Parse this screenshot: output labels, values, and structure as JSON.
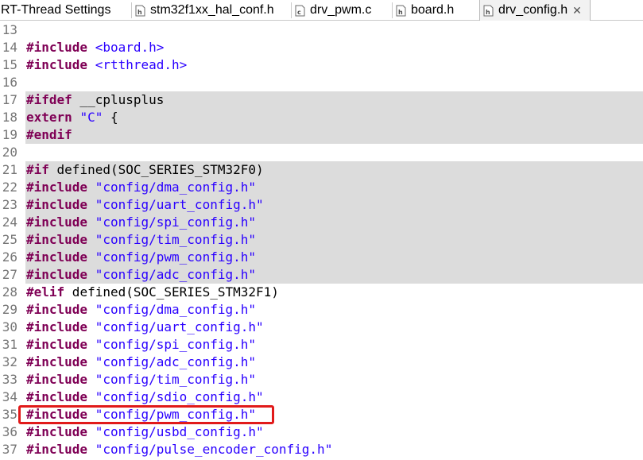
{
  "tabs": [
    {
      "label": "RT-Thread Settings",
      "icon": "none"
    },
    {
      "label": "stm32f1xx_hal_conf.h",
      "icon": "header-file-icon"
    },
    {
      "label": "drv_pwm.c",
      "icon": "c-file-icon"
    },
    {
      "label": "board.h",
      "icon": "header-file-icon"
    },
    {
      "label": "drv_config.h",
      "icon": "header-file-icon",
      "active": true,
      "close": "✕"
    }
  ],
  "editor": {
    "lines": [
      {
        "num": "13",
        "shaded": false,
        "tokens": []
      },
      {
        "num": "14",
        "shaded": false,
        "tokens": [
          {
            "t": "#include",
            "c": "kw"
          },
          {
            "t": " "
          },
          {
            "t": "<board.h>",
            "c": "str"
          }
        ]
      },
      {
        "num": "15",
        "shaded": false,
        "tokens": [
          {
            "t": "#include",
            "c": "kw"
          },
          {
            "t": " "
          },
          {
            "t": "<rtthread.h>",
            "c": "str"
          }
        ]
      },
      {
        "num": "16",
        "shaded": false,
        "tokens": []
      },
      {
        "num": "17",
        "shaded": true,
        "tokens": [
          {
            "t": "#ifdef",
            "c": "kw"
          },
          {
            "t": " __cplusplus"
          }
        ]
      },
      {
        "num": "18",
        "shaded": true,
        "tokens": [
          {
            "t": "extern",
            "c": "kw"
          },
          {
            "t": " "
          },
          {
            "t": "\"C\"",
            "c": "str"
          },
          {
            "t": " {"
          }
        ]
      },
      {
        "num": "19",
        "shaded": true,
        "tokens": [
          {
            "t": "#endif",
            "c": "kw"
          }
        ]
      },
      {
        "num": "20",
        "shaded": false,
        "tokens": []
      },
      {
        "num": "21",
        "shaded": true,
        "tokens": [
          {
            "t": "#if",
            "c": "kw"
          },
          {
            "t": " defined(SOC_SERIES_STM32F0)"
          }
        ]
      },
      {
        "num": "22",
        "shaded": true,
        "tokens": [
          {
            "t": "#include",
            "c": "kw"
          },
          {
            "t": " "
          },
          {
            "t": "\"config/dma_config.h\"",
            "c": "str"
          }
        ]
      },
      {
        "num": "23",
        "shaded": true,
        "tokens": [
          {
            "t": "#include",
            "c": "kw"
          },
          {
            "t": " "
          },
          {
            "t": "\"config/uart_config.h\"",
            "c": "str"
          }
        ]
      },
      {
        "num": "24",
        "shaded": true,
        "tokens": [
          {
            "t": "#include",
            "c": "kw"
          },
          {
            "t": " "
          },
          {
            "t": "\"config/spi_config.h\"",
            "c": "str"
          }
        ]
      },
      {
        "num": "25",
        "shaded": true,
        "tokens": [
          {
            "t": "#include",
            "c": "kw"
          },
          {
            "t": " "
          },
          {
            "t": "\"config/tim_config.h\"",
            "c": "str"
          }
        ]
      },
      {
        "num": "26",
        "shaded": true,
        "tokens": [
          {
            "t": "#include",
            "c": "kw"
          },
          {
            "t": " "
          },
          {
            "t": "\"config/pwm_config.h\"",
            "c": "str"
          }
        ]
      },
      {
        "num": "27",
        "shaded": true,
        "tokens": [
          {
            "t": "#include",
            "c": "kw"
          },
          {
            "t": " "
          },
          {
            "t": "\"config/adc_config.h\"",
            "c": "str"
          }
        ]
      },
      {
        "num": "28",
        "shaded": false,
        "tokens": [
          {
            "t": "#elif",
            "c": "kw"
          },
          {
            "t": " defined(SOC_SERIES_STM32F1)"
          }
        ]
      },
      {
        "num": "29",
        "shaded": false,
        "tokens": [
          {
            "t": "#include",
            "c": "kw"
          },
          {
            "t": " "
          },
          {
            "t": "\"config/dma_config.h\"",
            "c": "str"
          }
        ]
      },
      {
        "num": "30",
        "shaded": false,
        "tokens": [
          {
            "t": "#include",
            "c": "kw"
          },
          {
            "t": " "
          },
          {
            "t": "\"config/uart_config.h\"",
            "c": "str"
          }
        ]
      },
      {
        "num": "31",
        "shaded": false,
        "tokens": [
          {
            "t": "#include",
            "c": "kw"
          },
          {
            "t": " "
          },
          {
            "t": "\"config/spi_config.h\"",
            "c": "str"
          }
        ]
      },
      {
        "num": "32",
        "shaded": false,
        "tokens": [
          {
            "t": "#include",
            "c": "kw"
          },
          {
            "t": " "
          },
          {
            "t": "\"config/adc_config.h\"",
            "c": "str"
          }
        ]
      },
      {
        "num": "33",
        "shaded": false,
        "tokens": [
          {
            "t": "#include",
            "c": "kw"
          },
          {
            "t": " "
          },
          {
            "t": "\"config/tim_config.h\"",
            "c": "str"
          }
        ]
      },
      {
        "num": "34",
        "shaded": false,
        "tokens": [
          {
            "t": "#include",
            "c": "kw"
          },
          {
            "t": " "
          },
          {
            "t": "\"config/sdio_config.h\"",
            "c": "str"
          }
        ]
      },
      {
        "num": "35",
        "shaded": false,
        "highlighted": true,
        "tokens": [
          {
            "t": "#include",
            "c": "kw"
          },
          {
            "t": " "
          },
          {
            "t": "\"config/pwm_config.h\"",
            "c": "str"
          }
        ]
      },
      {
        "num": "36",
        "shaded": false,
        "tokens": [
          {
            "t": "#include",
            "c": "kw"
          },
          {
            "t": " "
          },
          {
            "t": "\"config/usbd_config.h\"",
            "c": "str"
          }
        ]
      },
      {
        "num": "37",
        "shaded": false,
        "tokens": [
          {
            "t": "#include",
            "c": "kw"
          },
          {
            "t": " "
          },
          {
            "t": "\"config/pulse_encoder_config.h\"",
            "c": "str"
          }
        ]
      }
    ],
    "highlight_color": "#e11a1a"
  }
}
